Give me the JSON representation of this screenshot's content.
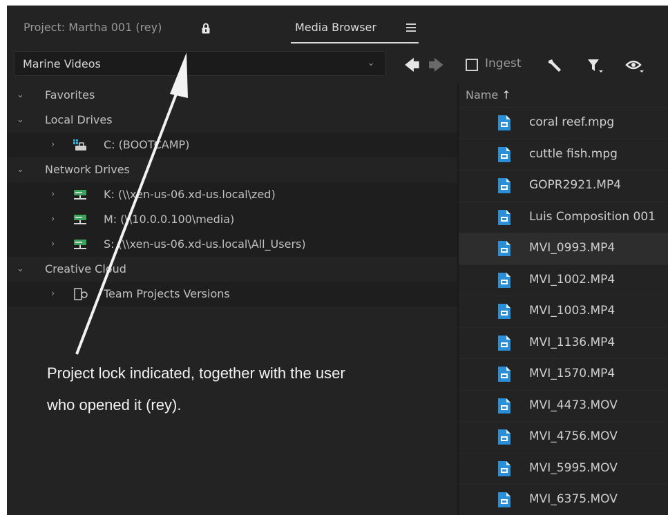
{
  "tabs": {
    "project_label": "Project: Martha 001 (rey)",
    "media_browser_label": "Media Browser"
  },
  "location": {
    "selected": "Marine Videos"
  },
  "toolbar": {
    "ingest_label": "Ingest",
    "icons": [
      "back-arrow",
      "forward-arrow",
      "wrench",
      "filter",
      "eye"
    ]
  },
  "tree": {
    "favorites": "Favorites",
    "local_drives": "Local Drives",
    "drive_c": "C: (BOOTCAMP)",
    "network_drives": "Network Drives",
    "drive_k": "K: (\\\\xen-us-06.xd-us.local\\zed)",
    "drive_m": "M: (\\\\10.0.0.100\\media)",
    "drive_s": "S: (\\\\xen-us-06.xd-us.local\\All_Users)",
    "creative_cloud": "Creative Cloud",
    "team_projects": "Team Projects Versions"
  },
  "files": {
    "column_name": "Name",
    "sort_indicator": "↑",
    "items": [
      "coral reef.mpg",
      "cuttle fish.mpg",
      "GOPR2921.MP4",
      "Luis Composition 001",
      "MVI_0993.MP4",
      "MVI_1002.MP4",
      "MVI_1003.MP4",
      "MVI_1136.MP4",
      "MVI_1570.MP4",
      "MVI_4473.MOV",
      "MVI_4756.MOV",
      "MVI_5995.MOV",
      "MVI_6375.MOV"
    ],
    "selected_item": "MVI_0993.MP4"
  },
  "annotation": {
    "line1": "Project lock indicated, together with the user",
    "line2": "who opened it (rey)."
  },
  "colors": {
    "panel_bg": "#232323",
    "file_icon": "#2b8fd8",
    "drive_icon": "#3aa55a"
  }
}
